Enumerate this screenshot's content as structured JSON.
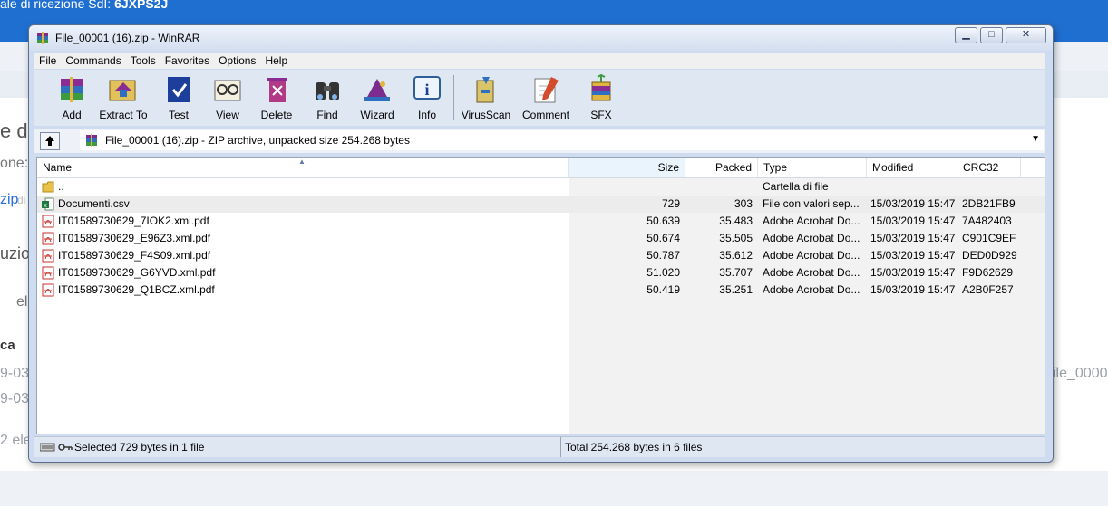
{
  "background": {
    "header_text": "ale di ricezione SdI:",
    "header_code": "6JXPS2J",
    "fragments": [
      "e do",
      "one:",
      "zip",
      "di",
      "uzio",
      "el",
      "ca",
      "9-03",
      "9-03",
      "2 ele",
      "ile_0000"
    ]
  },
  "window": {
    "title": "File_00001 (16).zip - WinRAR",
    "controls": {
      "minimize": "▁",
      "maximize": "□",
      "close": "✕"
    }
  },
  "menu": [
    "File",
    "Commands",
    "Tools",
    "Favorites",
    "Options",
    "Help"
  ],
  "toolbar": [
    {
      "label": "Add",
      "icon": "add-archive-icon"
    },
    {
      "label": "Extract To",
      "icon": "extract-icon"
    },
    {
      "label": "Test",
      "icon": "test-icon"
    },
    {
      "label": "View",
      "icon": "view-icon"
    },
    {
      "label": "Delete",
      "icon": "delete-icon"
    },
    {
      "label": "Find",
      "icon": "find-icon"
    },
    {
      "label": "Wizard",
      "icon": "wizard-icon"
    },
    {
      "label": "Info",
      "icon": "info-icon"
    },
    {
      "label": "VirusScan",
      "icon": "virusscan-icon"
    },
    {
      "label": "Comment",
      "icon": "comment-icon"
    },
    {
      "label": "SFX",
      "icon": "sfx-icon"
    }
  ],
  "address": {
    "text": "File_00001 (16).zip - ZIP archive, unpacked size 254.268 bytes"
  },
  "columns": [
    "Name",
    "Size",
    "Packed",
    "Type",
    "Modified",
    "CRC32"
  ],
  "files": [
    {
      "name": "..",
      "size": "",
      "packed": "",
      "type": "Cartella di file",
      "modified": "",
      "crc": "",
      "icon": "folder-icon",
      "selected": false
    },
    {
      "name": "Documenti.csv",
      "size": "729",
      "packed": "303",
      "type": "File con valori sep...",
      "modified": "15/03/2019 15:47",
      "crc": "2DB21FB9",
      "icon": "excel-csv-icon",
      "selected": true
    },
    {
      "name": "IT01589730629_7IOK2.xml.pdf",
      "size": "50.639",
      "packed": "35.483",
      "type": "Adobe Acrobat Do...",
      "modified": "15/03/2019 15:47",
      "crc": "7A482403",
      "icon": "pdf-icon",
      "selected": false
    },
    {
      "name": "IT01589730629_E96Z3.xml.pdf",
      "size": "50.674",
      "packed": "35.505",
      "type": "Adobe Acrobat Do...",
      "modified": "15/03/2019 15:47",
      "crc": "C901C9EF",
      "icon": "pdf-icon",
      "selected": false
    },
    {
      "name": "IT01589730629_F4S09.xml.pdf",
      "size": "50.787",
      "packed": "35.612",
      "type": "Adobe Acrobat Do...",
      "modified": "15/03/2019 15:47",
      "crc": "DED0D929",
      "icon": "pdf-icon",
      "selected": false
    },
    {
      "name": "IT01589730629_G6YVD.xml.pdf",
      "size": "51.020",
      "packed": "35.707",
      "type": "Adobe Acrobat Do...",
      "modified": "15/03/2019 15:47",
      "crc": "F9D62629",
      "icon": "pdf-icon",
      "selected": false
    },
    {
      "name": "IT01589730629_Q1BCZ.xml.pdf",
      "size": "50.419",
      "packed": "35.251",
      "type": "Adobe Acrobat Do...",
      "modified": "15/03/2019 15:47",
      "crc": "A2B0F257",
      "icon": "pdf-icon",
      "selected": false
    }
  ],
  "status": {
    "left": "Selected 729 bytes in 1 file",
    "right": "Total 254.268 bytes in 6 files"
  }
}
